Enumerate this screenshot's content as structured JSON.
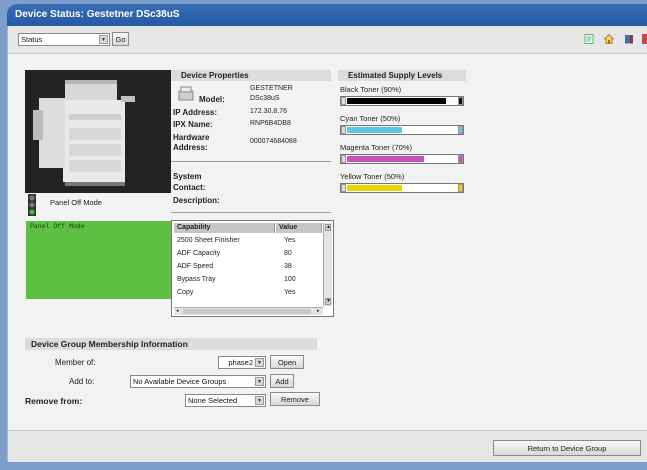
{
  "window": {
    "title": "Device Status: Gestetner DSc38uS"
  },
  "toolbar": {
    "view_select": "Status",
    "go_label": "Go",
    "icons": [
      "page-icon",
      "home-icon",
      "book-icon"
    ]
  },
  "device": {
    "panel_mode_label": "Panel Off Mode",
    "panel_display_text": "Panel Off Mode"
  },
  "properties": {
    "heading": "Device Properties",
    "model_label": "Model:",
    "model_brand": "GESTETNER",
    "model_value": "DSc38uS",
    "ip_label": "IP Address:",
    "ip_value": "172.30.8.76",
    "ipx_label": "IPX Name:",
    "ipx_value": "RNP6B4DB8",
    "hw_label_1": "Hardware",
    "hw_label_2": "Address:",
    "hw_value": "000074684088",
    "system_label": "System",
    "contact_label": "Contact:",
    "description_label": "Description:"
  },
  "capabilities": {
    "col_capability": "Capability",
    "col_value": "Value",
    "rows": [
      {
        "name": "2500 Sheet Finisher",
        "value": "Yes"
      },
      {
        "name": "ADF Capacity",
        "value": "80"
      },
      {
        "name": "ADF Speed",
        "value": "38"
      },
      {
        "name": "Bypass Tray",
        "value": "100"
      },
      {
        "name": "Copy",
        "value": "Yes"
      }
    ]
  },
  "supplies": {
    "heading": "Estimated Supply Levels",
    "items": [
      {
        "label": "Black Toner (90%)",
        "level": 0.9,
        "color": "#000000"
      },
      {
        "label": "Cyan Toner (50%)",
        "level": 0.5,
        "color": "#5ec8e0"
      },
      {
        "label": "Magenta Toner (70%)",
        "level": 0.7,
        "color": "#c850b8"
      },
      {
        "label": "Yellow Toner (50%)",
        "level": 0.5,
        "color": "#e8d800"
      }
    ]
  },
  "membership": {
    "heading": "Device Group Membership Information",
    "member_of_label": "Member of:",
    "member_of_value": "phase2",
    "open_label": "Open",
    "add_to_label": "Add to:",
    "add_to_value": "No Available Device Groups",
    "add_label": "Add",
    "remove_from_label": "Remove from:",
    "remove_from_value": "None Selected",
    "remove_label": "Remove"
  },
  "footer": {
    "return_label": "Return to Device Group"
  }
}
